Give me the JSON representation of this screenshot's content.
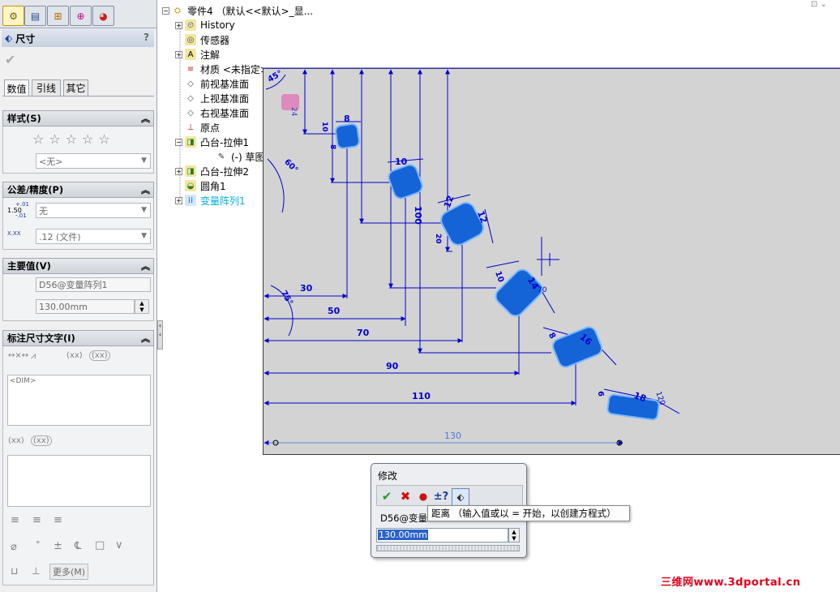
{
  "property_manager": {
    "header_title": "尺寸",
    "help_label": "?",
    "tabs": [
      "数值",
      "引线",
      "其它"
    ],
    "style_group": {
      "title": "样式(S)",
      "style_combo": "<无>"
    },
    "tolerance_group": {
      "title": "公差/精度(P)",
      "tol_icon_top": "1.50",
      "tol_icon_sup": "+.01",
      "tol_icon_sub": "-.01",
      "tol_value": "无",
      "prec_icon": "X.XX",
      "prec_value": ".12 (文件)"
    },
    "primary_value_group": {
      "title": "主要值(V)",
      "name": "D56@变量阵列1",
      "value": "130.00mm"
    },
    "dim_text_group": {
      "title": "标注尺寸文字(I)",
      "xx1": "(xx)",
      "xx2": "(xx)",
      "xx3": "(xx)",
      "xx4": "(xx)",
      "dim_text": "<DIM>",
      "more_label": "更多(M)"
    }
  },
  "feature_tree": {
    "root": "零件4 （默认<<默认>_显...",
    "items": [
      {
        "label": "History",
        "icon": "history-icon",
        "color": "#000000"
      },
      {
        "label": "传感器",
        "icon": "sensor-icon",
        "color": "#000000"
      },
      {
        "label": "注解",
        "icon": "annotation-icon",
        "color": "#000000"
      },
      {
        "label": "材质 <未指定>",
        "icon": "material-icon",
        "color": "#000000"
      },
      {
        "label": "前视基准面",
        "icon": "plane-icon",
        "color": "#000000"
      },
      {
        "label": "上视基准面",
        "icon": "plane-icon",
        "color": "#000000"
      },
      {
        "label": "右视基准面",
        "icon": "plane-icon",
        "color": "#000000"
      },
      {
        "label": "原点",
        "icon": "origin-icon",
        "color": "#000000"
      },
      {
        "label": "凸台-拉伸1",
        "icon": "extrude-icon",
        "color": "#000000"
      },
      {
        "label": "(-) 草图1",
        "icon": "sketch-icon",
        "color": "#000000"
      },
      {
        "label": "凸台-拉伸2",
        "icon": "extrude-icon",
        "color": "#000000"
      },
      {
        "label": "圆角1",
        "icon": "fillet-icon",
        "color": "#000000"
      },
      {
        "label": "变量阵列1",
        "icon": "pattern-icon",
        "color": "#00b0e0"
      }
    ]
  },
  "drawing": {
    "dims": [
      "8",
      "10",
      "12",
      "12",
      "14",
      "16",
      "18",
      "30",
      "50",
      "70",
      "90",
      "110",
      "130",
      "100",
      "120",
      "70",
      "45°",
      "60°",
      "75°",
      "8",
      "10",
      "10",
      "20",
      "8",
      "6"
    ]
  },
  "modify_dialog": {
    "title": "修改",
    "dim_name": "D56@变量",
    "value": "130.00mm",
    "tooltip": "距离 （输入值或以 = 开始，以创建方程式）"
  },
  "watermark": "三维网www.3dportal.cn",
  "colors": {
    "accent": "#0000cc",
    "feature_blue": "#1464d8",
    "highlight": "#00b0e0"
  }
}
